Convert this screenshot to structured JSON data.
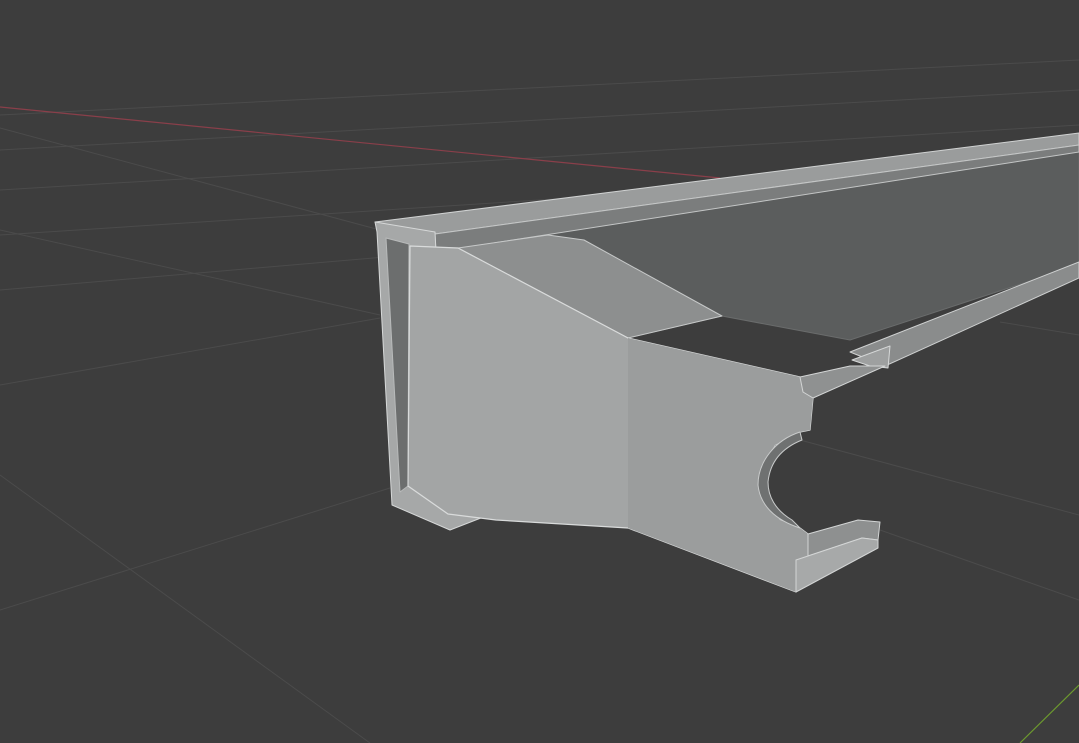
{
  "viewport": {
    "mode": "3d-viewport",
    "shading": "solid",
    "background_color": "#3d3d3d",
    "grid_line_color": "#4b4b4b",
    "x_axis_color": "#8a3f4a",
    "y_axis_color": "#6d9a2e"
  },
  "model": {
    "object": "bracket-beam-mesh",
    "face_light_color": "#a3a5a5",
    "face_mid_color": "#8b8d8d",
    "face_dark_color": "#5d5f5f",
    "edge_color": "#d6d8d8"
  }
}
